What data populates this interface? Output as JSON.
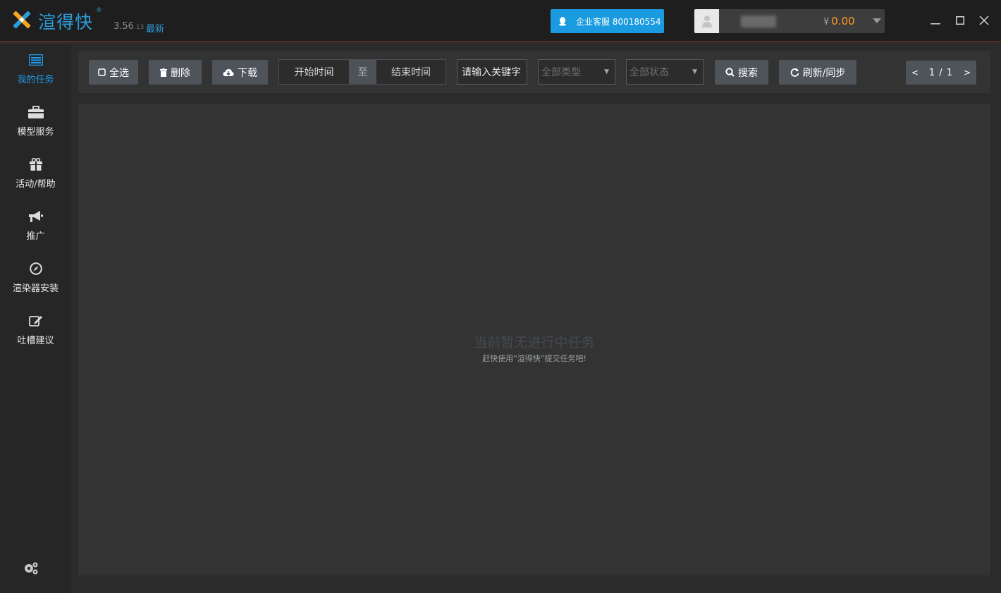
{
  "app": {
    "name": "渲得快",
    "reg_mark": "®",
    "version_major": "3.56",
    "version_minor": ".13",
    "version_status": "最新"
  },
  "header": {
    "support_label": "企业客服 800180554",
    "balance_symbol": "¥",
    "balance_value": "0.00"
  },
  "sidebar": {
    "items": [
      {
        "label": "我的任务",
        "icon": "task-list-icon",
        "active": true
      },
      {
        "label": "模型服务",
        "icon": "briefcase-icon",
        "active": false
      },
      {
        "label": "活动/帮助",
        "icon": "gift-icon",
        "active": false
      },
      {
        "label": "推广",
        "icon": "megaphone-icon",
        "active": false
      },
      {
        "label": "渲染器安装",
        "icon": "compass-icon",
        "active": false
      },
      {
        "label": "吐槽建议",
        "icon": "edit-icon",
        "active": false
      }
    ],
    "settings_icon": "gears-icon"
  },
  "toolbar": {
    "select_all": "全选",
    "delete": "删除",
    "download": "下载",
    "start_time": "开始时间",
    "to": "至",
    "end_time": "结束时间",
    "keyword_placeholder": "请输入关键字",
    "type_select": "全部类型",
    "status_select": "全部状态",
    "search": "搜索",
    "refresh": "刷新/同步",
    "pager_prev": "<",
    "pager_text": "1 / 1",
    "pager_next": ">"
  },
  "main": {
    "empty_title": "当前暂无进行中任务",
    "empty_subtitle": "赶快使用“渲得快”提交任务吧!"
  },
  "colors": {
    "accent": "#1e9df1",
    "balance": "#ff9b21",
    "support_bg": "#1a9be0"
  }
}
